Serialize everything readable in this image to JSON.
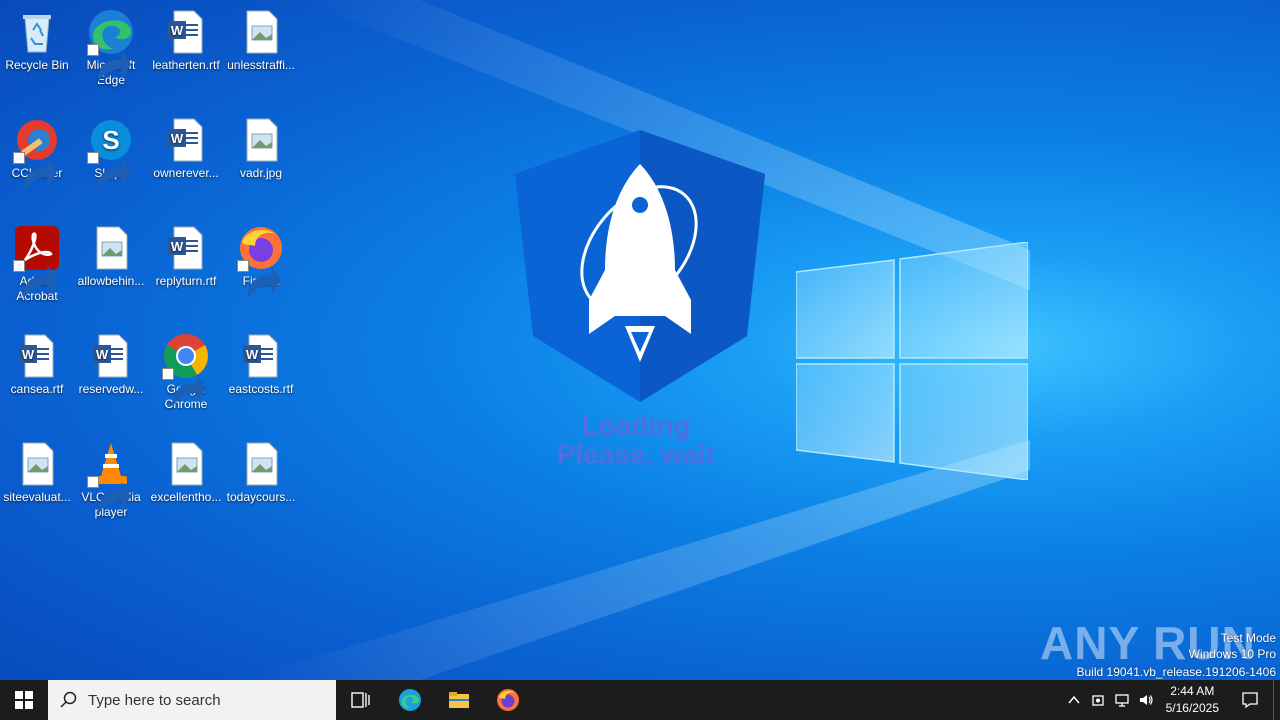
{
  "desktop": {
    "icons": [
      {
        "label": "Recycle Bin",
        "icon": "recycle-bin-icon"
      },
      {
        "label": "Microsoft Edge",
        "icon": "edge-icon"
      },
      {
        "label": "leatherten.rtf",
        "icon": "word-doc-icon"
      },
      {
        "label": "unlesstraffi...",
        "icon": "image-file-icon"
      },
      {
        "label": "CCleaner",
        "icon": "ccleaner-icon"
      },
      {
        "label": "Skype",
        "icon": "skype-icon"
      },
      {
        "label": "ownerever...",
        "icon": "word-doc-icon"
      },
      {
        "label": "vadr.jpg",
        "icon": "image-file-icon"
      },
      {
        "label": "Adobe Acrobat",
        "icon": "acrobat-icon"
      },
      {
        "label": "allowbehin...",
        "icon": "image-file-icon"
      },
      {
        "label": "replyturn.rtf",
        "icon": "word-doc-icon"
      },
      {
        "label": "Firefox",
        "icon": "firefox-icon"
      },
      {
        "label": "cansea.rtf",
        "icon": "word-doc-icon"
      },
      {
        "label": "reservedw...",
        "icon": "word-doc-icon"
      },
      {
        "label": "Google Chrome",
        "icon": "chrome-icon"
      },
      {
        "label": "eastcosts.rtf",
        "icon": "word-doc-icon"
      },
      {
        "label": "siteevaluat...",
        "icon": "image-file-icon"
      },
      {
        "label": "VLC media player",
        "icon": "vlc-icon"
      },
      {
        "label": "excellentho...",
        "icon": "image-file-icon"
      },
      {
        "label": "todaycours...",
        "icon": "image-file-icon"
      }
    ]
  },
  "loader": {
    "line1": "Loading",
    "line2": "Please, wait",
    "icon": "rocket-shield-icon"
  },
  "watermark": {
    "brand": "ANY RUN",
    "mode": "Test Mode",
    "os": "Windows 10 Pro",
    "build": "Build 19041.vb_release.191206-1406"
  },
  "taskbar": {
    "search_placeholder": "Type here to search",
    "pinned": [
      "task-view-icon",
      "edge-icon",
      "file-explorer-icon",
      "firefox-icon"
    ],
    "time": "2:44 AM",
    "date": "5/16/2025"
  },
  "colors": {
    "loading_text": "#4f6fe0",
    "taskbar_bg": "#1c1c1c",
    "wallpaper_accent": "#1a9ef5"
  }
}
